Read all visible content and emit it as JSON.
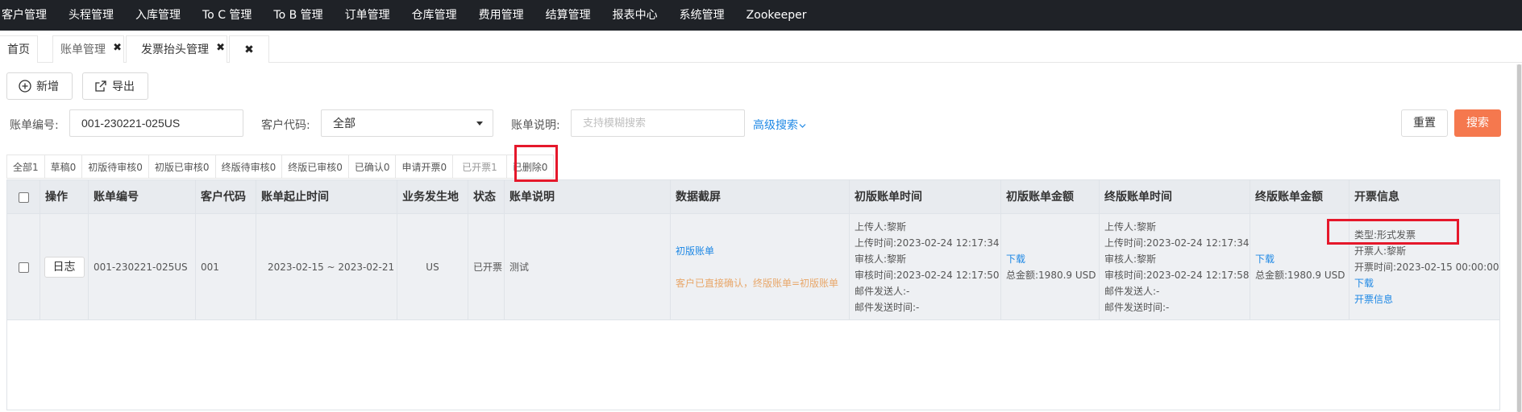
{
  "topnav": [
    "客户管理",
    "头程管理",
    "入库管理",
    "To C 管理",
    "To B 管理",
    "订单管理",
    "仓库管理",
    "费用管理",
    "结算管理",
    "报表中心",
    "系统管理",
    "Zookeeper"
  ],
  "page_tabs": {
    "home": "首页",
    "bill": "账单管理",
    "invoice_header": "发票抬头管理",
    "close_glyph": "✖"
  },
  "toolbar": {
    "add": "新增",
    "export": "导出"
  },
  "search": {
    "bill_no_label": "账单编号:",
    "bill_no_value": "001-230221-025US",
    "customer_label": "客户代码:",
    "customer_value": "全部",
    "desc_label": "账单说明:",
    "desc_placeholder": "支持模糊搜索",
    "advanced": "高级搜索",
    "reset": "重置",
    "search": "搜索"
  },
  "status_tabs": [
    "全部1",
    "草稿0",
    "初版待审核0",
    "初版已审核0",
    "终版待审核0",
    "终版已审核0",
    "已确认0",
    "申请开票0",
    "已开票1",
    "已删除0"
  ],
  "table": {
    "headers": [
      "操作",
      "账单编号",
      "客户代码",
      "账单起止时间",
      "业务发生地",
      "状态",
      "账单说明",
      "数据截屏",
      "初版账单时间",
      "初版账单金额",
      "终版账单时间",
      "终版账单金额",
      "开票信息"
    ],
    "row": {
      "log_button": "日志",
      "bill_no": "001-230221-025US",
      "customer": "001",
      "period": "2023-02-15 ~ 2023-02-21",
      "location": "US",
      "status": "已开票",
      "desc": "测试",
      "screenshot_link": "初版账单",
      "screenshot_note": "客户已直接确认，终版账单=初版账单",
      "first_time": [
        "上传人:黎斯",
        "上传时间:2023-02-24 12:17:34",
        "审核人:黎斯",
        "审核时间:2023-02-24 12:17:50",
        "邮件发送人:-",
        "邮件发送时间:-"
      ],
      "first_amount_link": "下载",
      "first_amount_total": "总金额:1980.9 USD",
      "final_time": [
        "上传人:黎斯",
        "上传时间:2023-02-24 12:17:34",
        "审核人:黎斯",
        "审核时间:2023-02-24 12:17:58",
        "邮件发送人:-",
        "邮件发送时间:-"
      ],
      "final_amount_link": "下载",
      "final_amount_total": "总金额:1980.9 USD",
      "invoice_type": "类型:形式发票",
      "invoice_person": "开票人:黎斯",
      "invoice_time": "开票时间:2023-02-15 00:00:00",
      "invoice_download": "下载",
      "invoice_info": "开票信息"
    }
  },
  "colors": {
    "nav_bg": "#1f2227",
    "accent": "#f5784e",
    "link": "#1e88e5",
    "highlight": "#e5182b"
  }
}
